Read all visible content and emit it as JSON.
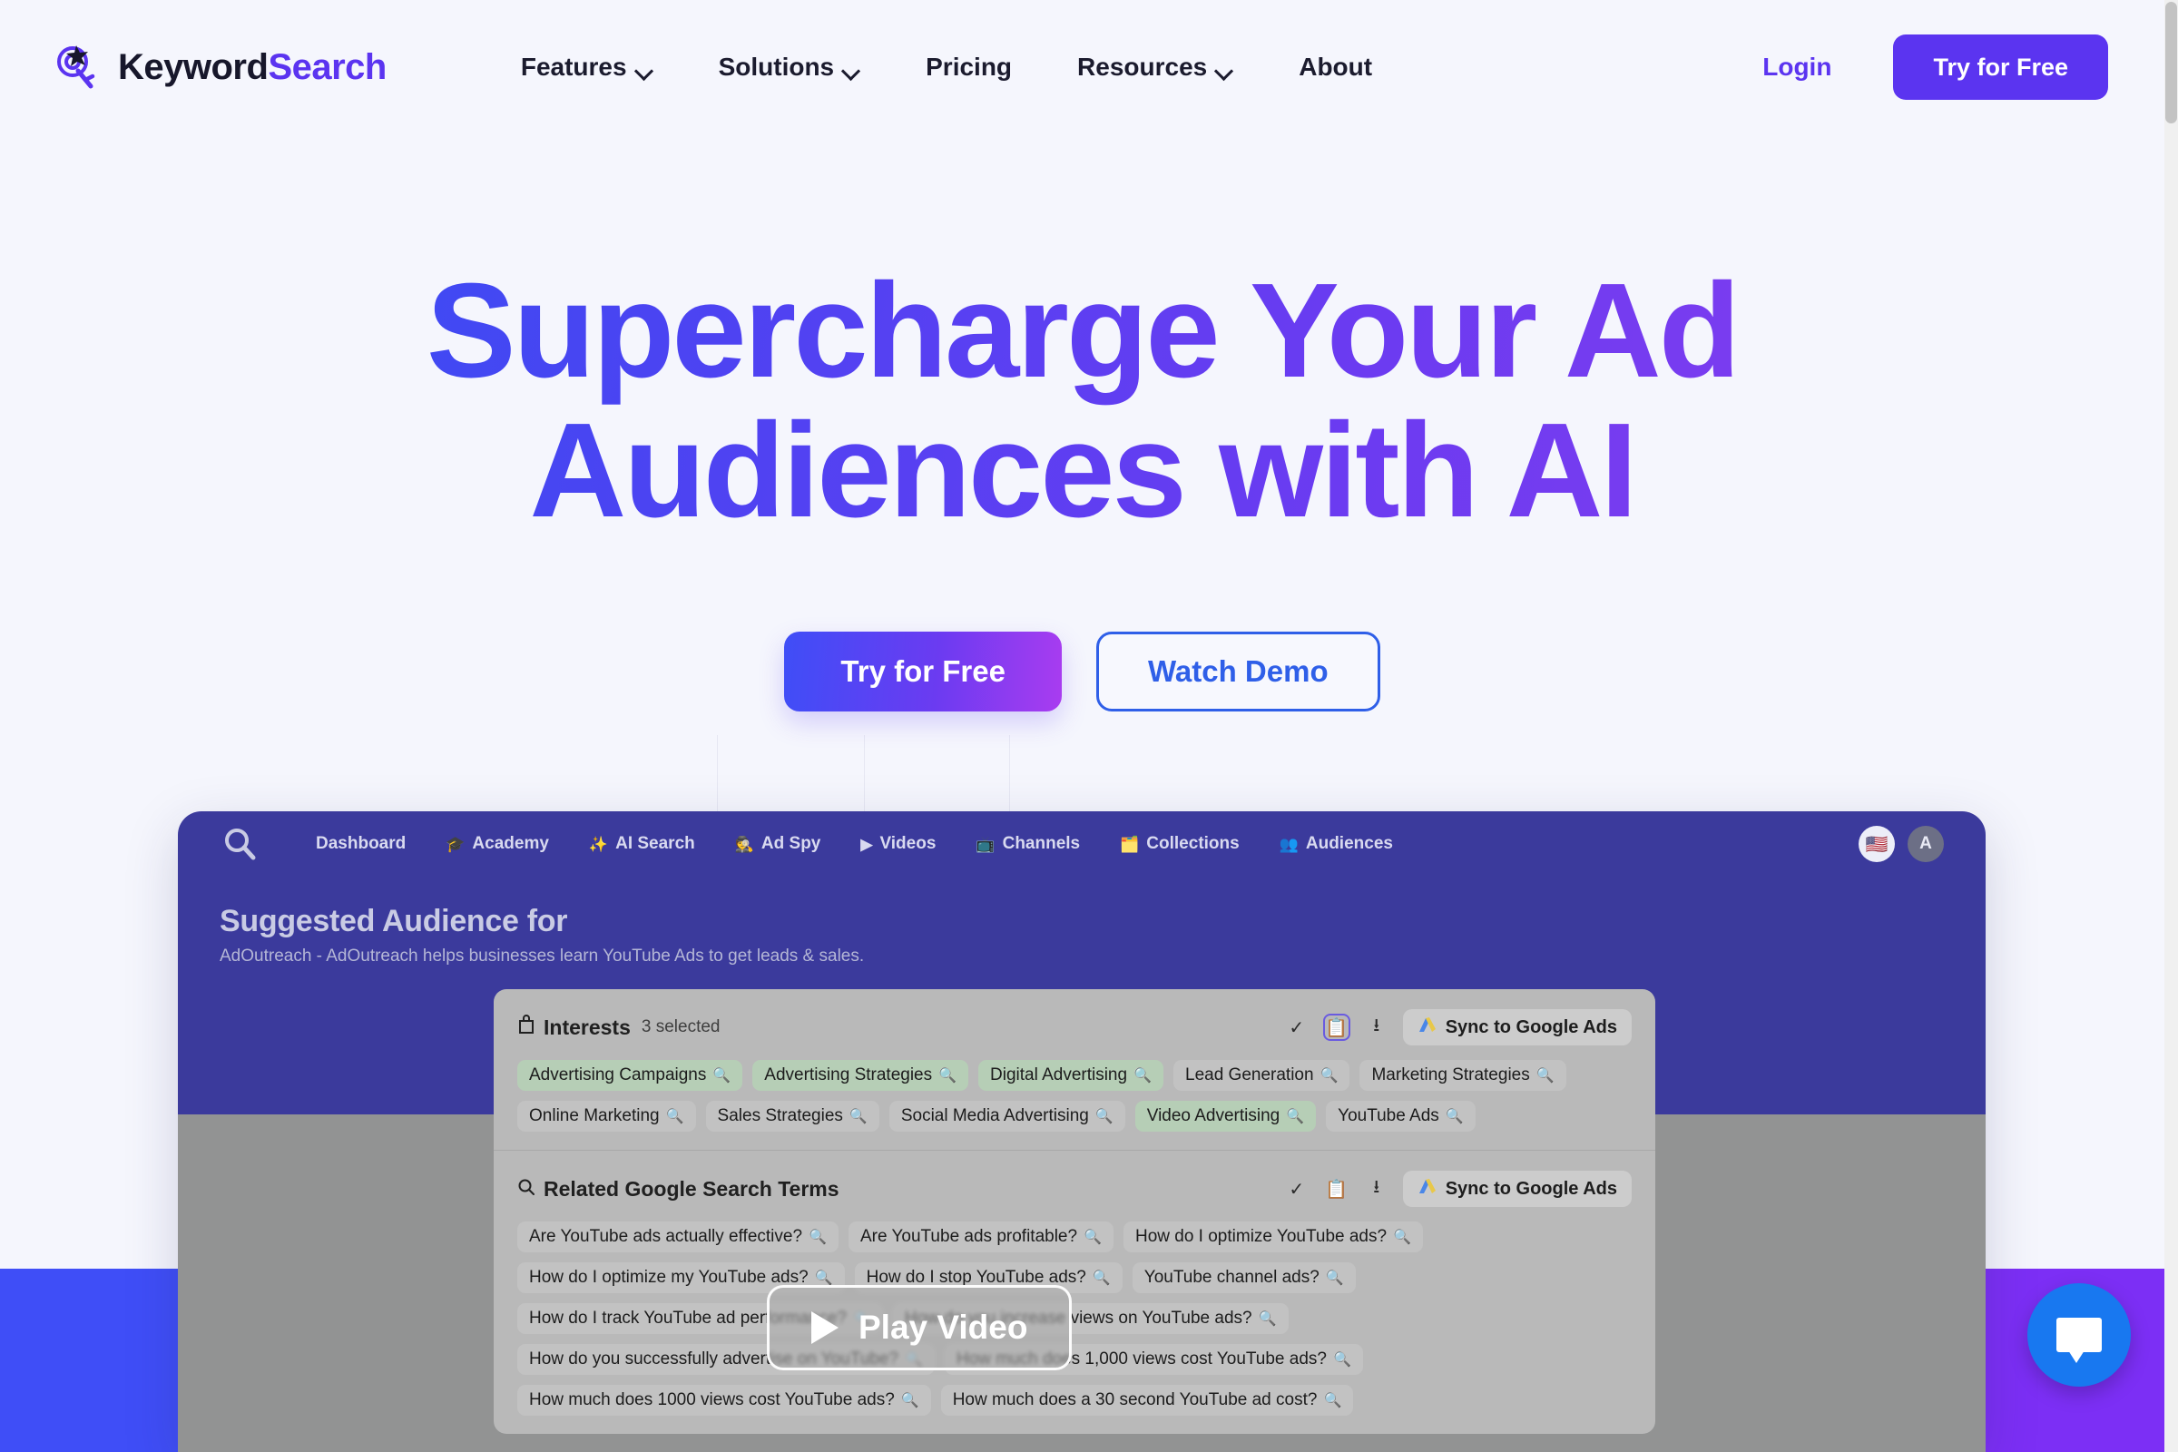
{
  "brand": {
    "name_part1": "Keyword",
    "name_part2": "Search",
    "logo_icon": "target-magnifier-key-icon"
  },
  "nav": {
    "items": [
      {
        "label": "Features",
        "has_dropdown": true
      },
      {
        "label": "Solutions",
        "has_dropdown": true
      },
      {
        "label": "Pricing",
        "has_dropdown": false
      },
      {
        "label": "Resources",
        "has_dropdown": true
      },
      {
        "label": "About",
        "has_dropdown": false
      }
    ],
    "login_label": "Login",
    "cta_label": "Try for Free"
  },
  "hero": {
    "title_line1": "Supercharge Your Ad",
    "title_line2": "Audiences with AI",
    "primary_cta": "Try for Free",
    "secondary_cta": "Watch Demo",
    "gradient_start": "#2f53f5",
    "gradient_end": "#8b3dee"
  },
  "mock": {
    "logo_icon": "magnifier-icon",
    "nav": [
      {
        "icon": "",
        "label": "Dashboard"
      },
      {
        "icon": "🎓",
        "label": "Academy"
      },
      {
        "icon": "✨",
        "label": "AI Search"
      },
      {
        "icon": "🕵️",
        "label": "Ad Spy"
      },
      {
        "icon": "▶",
        "label": "Videos"
      },
      {
        "icon": "📺",
        "label": "Channels"
      },
      {
        "icon": "🗂️",
        "label": "Collections"
      },
      {
        "icon": "👥",
        "label": "Audiences"
      }
    ],
    "flag_icon": "us-flag-icon",
    "avatar_initial": "A",
    "heading": "Suggested Audience for",
    "subheading": "AdOutreach - AdOutreach helps businesses learn YouTube Ads to get leads & sales.",
    "interests": {
      "icon": "shopping-bag-icon",
      "title": "Interests",
      "count_label": "3 selected",
      "sync_label": "Sync to Google Ads",
      "tags": [
        {
          "label": "Advertising Campaigns",
          "selected": false
        },
        {
          "label": "Advertising Strategies",
          "selected": true
        },
        {
          "label": "Digital Advertising",
          "selected": true
        },
        {
          "label": "Lead Generation",
          "selected": false
        },
        {
          "label": "Marketing Strategies",
          "selected": false
        },
        {
          "label": "Online Marketing",
          "selected": false
        },
        {
          "label": "Sales Strategies",
          "selected": false
        },
        {
          "label": "Social Media Advertising",
          "selected": false
        },
        {
          "label": "Video Advertising",
          "selected": true
        },
        {
          "label": "YouTube Ads",
          "selected": false
        }
      ]
    },
    "search_terms": {
      "icon": "search-icon",
      "title": "Related Google Search Terms",
      "sync_label": "Sync to Google Ads",
      "tags": [
        {
          "label": "Are YouTube ads actually effective?",
          "selected": false
        },
        {
          "label": "Are YouTube ads profitable?",
          "selected": false
        },
        {
          "label": "How do I optimize YouTube ads?",
          "selected": false
        },
        {
          "label": "How do I optimize my YouTube ads?",
          "selected": false
        },
        {
          "label": "How do I stop YouTube ads?",
          "selected": false
        },
        {
          "label": "YouTube channel ads?",
          "selected": false
        },
        {
          "label": "How do I track YouTube ad performance?",
          "selected": false
        },
        {
          "label": "How do you increase views on YouTube ads?",
          "selected": false
        },
        {
          "label": "How do you successfully advertise on YouTube?",
          "selected": false
        },
        {
          "label": "How much does 1,000 views cost YouTube ads?",
          "selected": false
        },
        {
          "label": "How much does 1000 views cost YouTube ads?",
          "selected": false
        },
        {
          "label": "How much does a 30 second YouTube ad cost?",
          "selected": false
        }
      ]
    },
    "play_label": "Play Video"
  },
  "chat": {
    "icon": "chat-bubble-icon",
    "color": "#1878f0"
  },
  "decor": {
    "left_color": "#3f4ef7",
    "right_color": "#7c2ff5"
  }
}
